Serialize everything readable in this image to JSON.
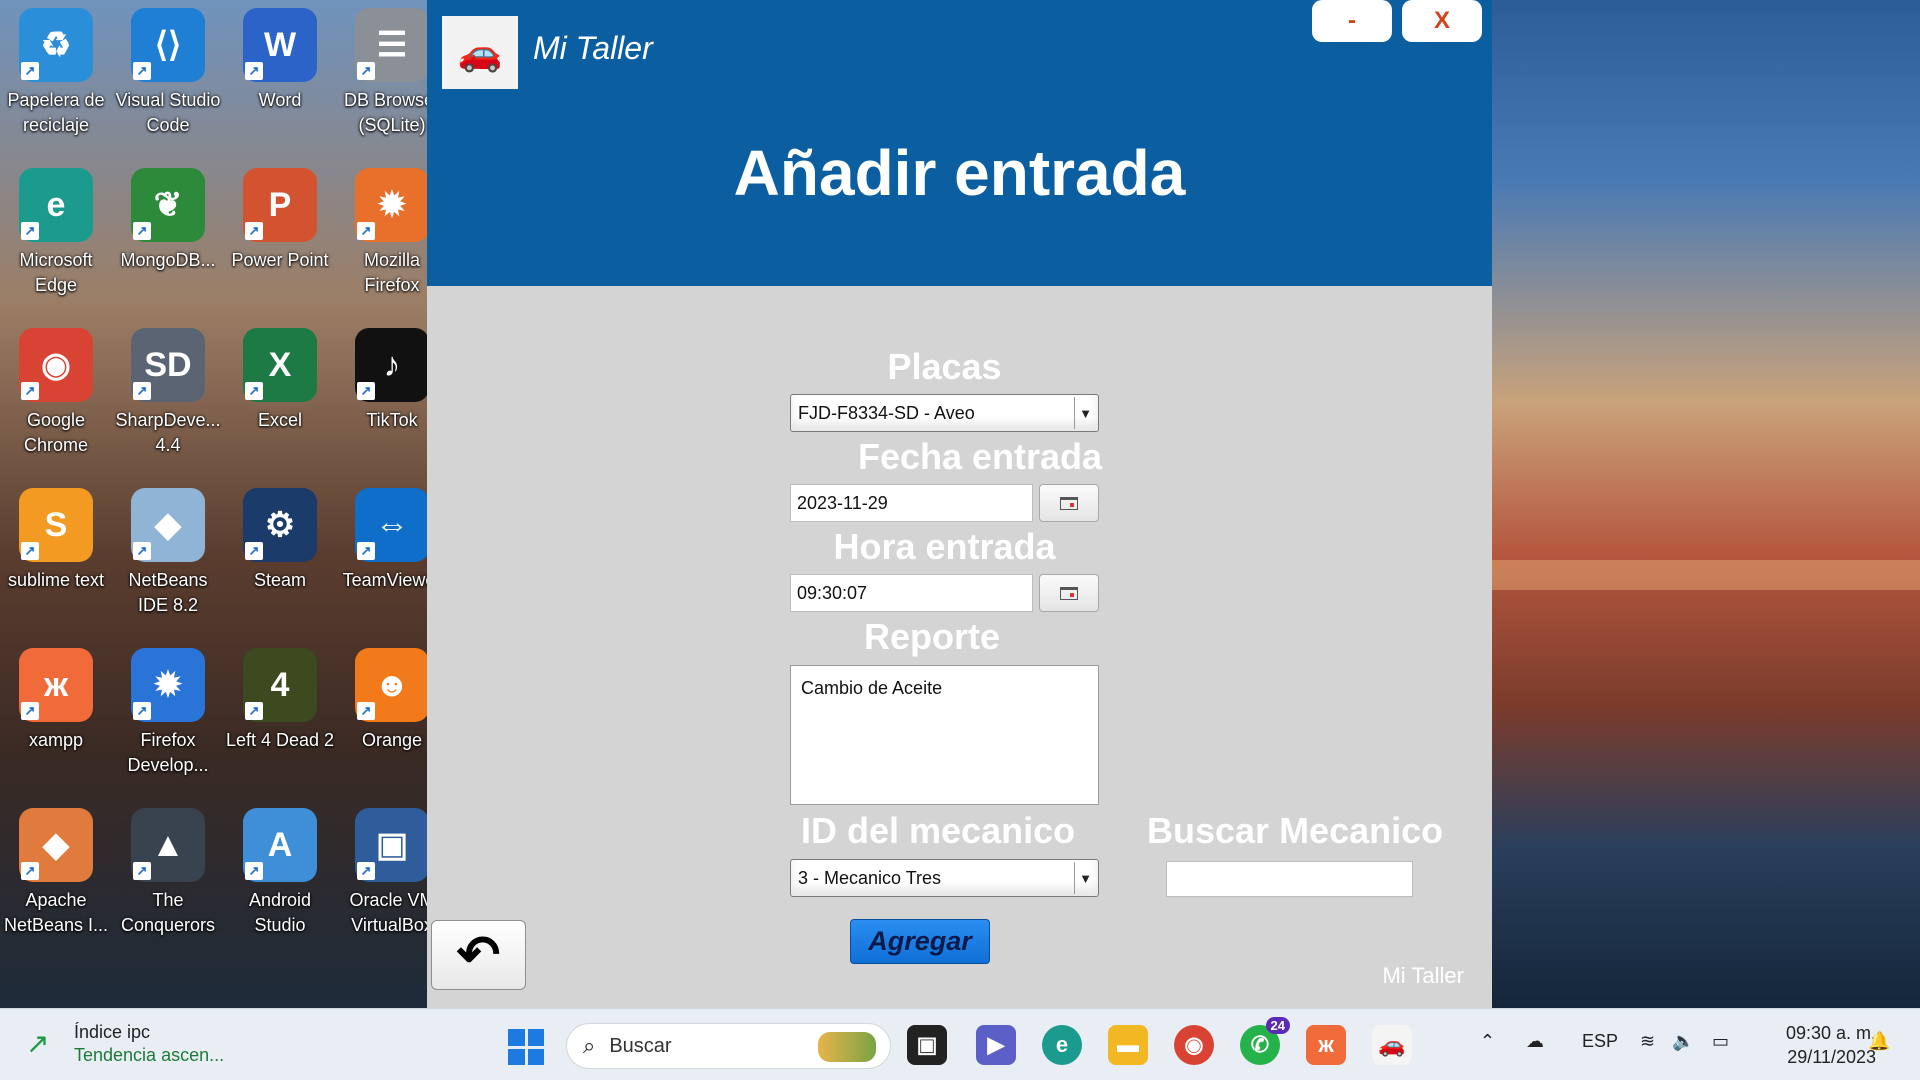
{
  "desktop": {
    "icons": [
      {
        "label": "Papelera de reciclaje",
        "glyph": "♻",
        "color": "#2a8fd8"
      },
      {
        "label": "Visual Studio Code",
        "glyph": "⟨⟩",
        "color": "#1f7fd4"
      },
      {
        "label": "Word",
        "glyph": "W",
        "color": "#2b63c9"
      },
      {
        "label": "DB Browser (SQLite)",
        "glyph": "☰",
        "color": "#8b8f96"
      },
      {
        "label": "Microsoft Edge",
        "glyph": "e",
        "color": "#1a9b8e"
      },
      {
        "label": "MongoDB...",
        "glyph": "❦",
        "color": "#2e8a3b"
      },
      {
        "label": "Power Point",
        "glyph": "P",
        "color": "#d35230"
      },
      {
        "label": "Mozilla Firefox",
        "glyph": "✹",
        "color": "#e8702a"
      },
      {
        "label": "Google Chrome",
        "glyph": "◉",
        "color": "#d94334"
      },
      {
        "label": "SharpDeve... 4.4",
        "glyph": "SD",
        "color": "#5a6472"
      },
      {
        "label": "Excel",
        "glyph": "X",
        "color": "#1d7a45"
      },
      {
        "label": "TikTok",
        "glyph": "♪",
        "color": "#111111"
      },
      {
        "label": "sublime text",
        "glyph": "S",
        "color": "#f39a23"
      },
      {
        "label": "NetBeans IDE 8.2",
        "glyph": "◆",
        "color": "#8fb4d6"
      },
      {
        "label": "Steam",
        "glyph": "⚙",
        "color": "#1b3b6b"
      },
      {
        "label": "TeamViewer",
        "glyph": "⇔",
        "color": "#0e6ec9"
      },
      {
        "label": "xampp",
        "glyph": "ж",
        "color": "#f06a3a"
      },
      {
        "label": "Firefox Develop...",
        "glyph": "✹",
        "color": "#2a74d8"
      },
      {
        "label": "Left 4 Dead 2",
        "glyph": "4",
        "color": "#3d4a1f"
      },
      {
        "label": "Orange",
        "glyph": "☻",
        "color": "#f27a1a"
      },
      {
        "label": "Apache NetBeans I...",
        "glyph": "◆",
        "color": "#e07a3d"
      },
      {
        "label": "The Conquerors",
        "glyph": "▲",
        "color": "#39424f"
      },
      {
        "label": "Android Studio",
        "glyph": "A",
        "color": "#3f8fd8"
      },
      {
        "label": "Oracle VM VirtualBox",
        "glyph": "▣",
        "color": "#2f5d9b"
      }
    ]
  },
  "app": {
    "name": "Mi Taller",
    "minimize_label": "-",
    "close_label": "X",
    "page_title": "Añadir entrada",
    "fields": {
      "placas_label": "Placas",
      "placas_value": "FJD-F8334-SD - Aveo",
      "fecha_label": "Fecha entrada",
      "fecha_value": "2023-11-29",
      "hora_label": "Hora entrada",
      "hora_value": "09:30:07",
      "reporte_label": "Reporte",
      "reporte_value": "Cambio de Aceite",
      "mecanico_label": "ID del mecanico",
      "mecanico_value": "3 - Mecanico Tres",
      "buscar_label": "Buscar Mecanico",
      "buscar_value": ""
    },
    "add_label": "Agregar",
    "back_icon": "↶",
    "footer_brand": "Mi Taller",
    "logo_icon": "🚗"
  },
  "taskbar": {
    "widget_title": "Índice ipc",
    "widget_sub": "Tendencia ascen...",
    "search_placeholder": "Buscar",
    "whatsapp_badge": "24",
    "lang": "ESP",
    "time": "09:30 a. m.",
    "date": "29/11/2023"
  }
}
